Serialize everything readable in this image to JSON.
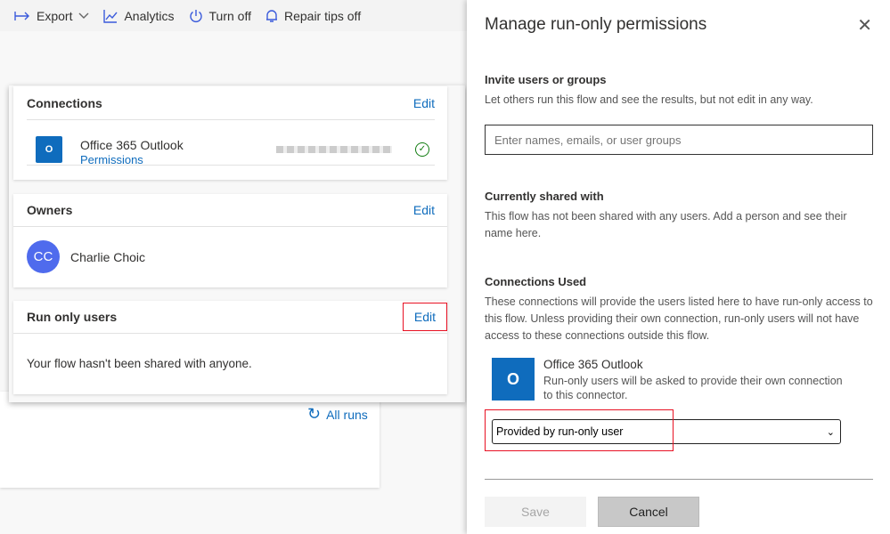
{
  "toolbar": {
    "export": "Export",
    "analytics": "Analytics",
    "turn_off": "Turn off",
    "repair_tips": "Repair tips off"
  },
  "connections": {
    "title": "Connections",
    "edit": "Edit",
    "item": {
      "name": "Office 365 Outlook",
      "link": "Permissions"
    }
  },
  "owners": {
    "title": "Owners",
    "edit": "Edit",
    "owner": {
      "initials": "CC",
      "name": "Charlie Choic"
    }
  },
  "run_only": {
    "title": "Run only users",
    "edit": "Edit",
    "message": "Your flow hasn't been shared with anyone."
  },
  "all_runs": "All runs",
  "panel": {
    "title": "Manage run-only permissions",
    "invite": {
      "heading": "Invite users or groups",
      "desc": "Let others run this flow and see the results, but not edit in any way.",
      "placeholder": "Enter names, emails, or user groups"
    },
    "shared": {
      "heading": "Currently shared with",
      "desc": "This flow has not been shared with any users. Add a person and see their name here."
    },
    "connections_used": {
      "heading": "Connections Used",
      "desc": "These connections will provide the users listed here to have run-only access to this flow. Unless providing their own connection, run-only users will not have access to these connections outside this flow.",
      "connector": {
        "name": "Office 365 Outlook",
        "desc": "Run-only users will be asked to provide their own connection to this connector."
      },
      "select_value": "Provided by run-only user"
    },
    "save": "Save",
    "cancel": "Cancel"
  },
  "colors": {
    "accent": "#0f6cbd",
    "highlight": "#e81123",
    "avatar": "#4f6bed",
    "success": "#107c10"
  }
}
